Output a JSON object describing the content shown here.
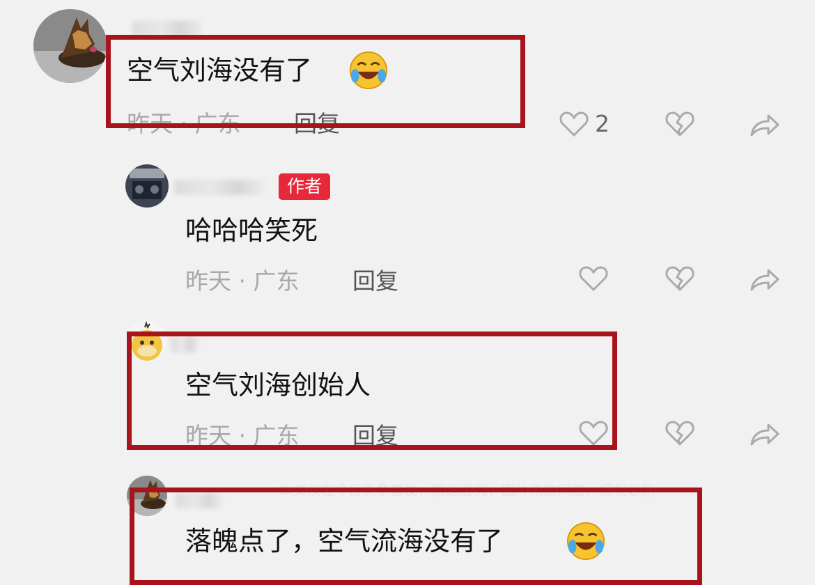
{
  "comments": [
    {
      "text": "空气刘海没有了",
      "meta": "昨天 · 广东",
      "reply_label": "回复",
      "like_count": "2",
      "emoji": "laughing-crying-emoji"
    },
    {
      "badge": "作者",
      "text": "哈哈哈笑死",
      "meta": "昨天 · 广东",
      "reply_label": "回复"
    },
    {
      "text": "空气刘海创始人",
      "meta": "昨天 · 广东",
      "reply_label": "回复"
    },
    {
      "text": "落魄点了，空气流海没有了",
      "emoji": "laughing-crying-emoji"
    }
  ],
  "watermark": "本文仅在今日头条首发，搬运必究，图片来自网络，侵权必删",
  "colors": {
    "background": "#f1f1f1",
    "highlight_box": "#a8141c",
    "author_badge": "#e5283a",
    "meta_text": "#a8a8a8"
  },
  "icons": [
    "heart-icon",
    "broken-heart-icon",
    "share-icon"
  ]
}
